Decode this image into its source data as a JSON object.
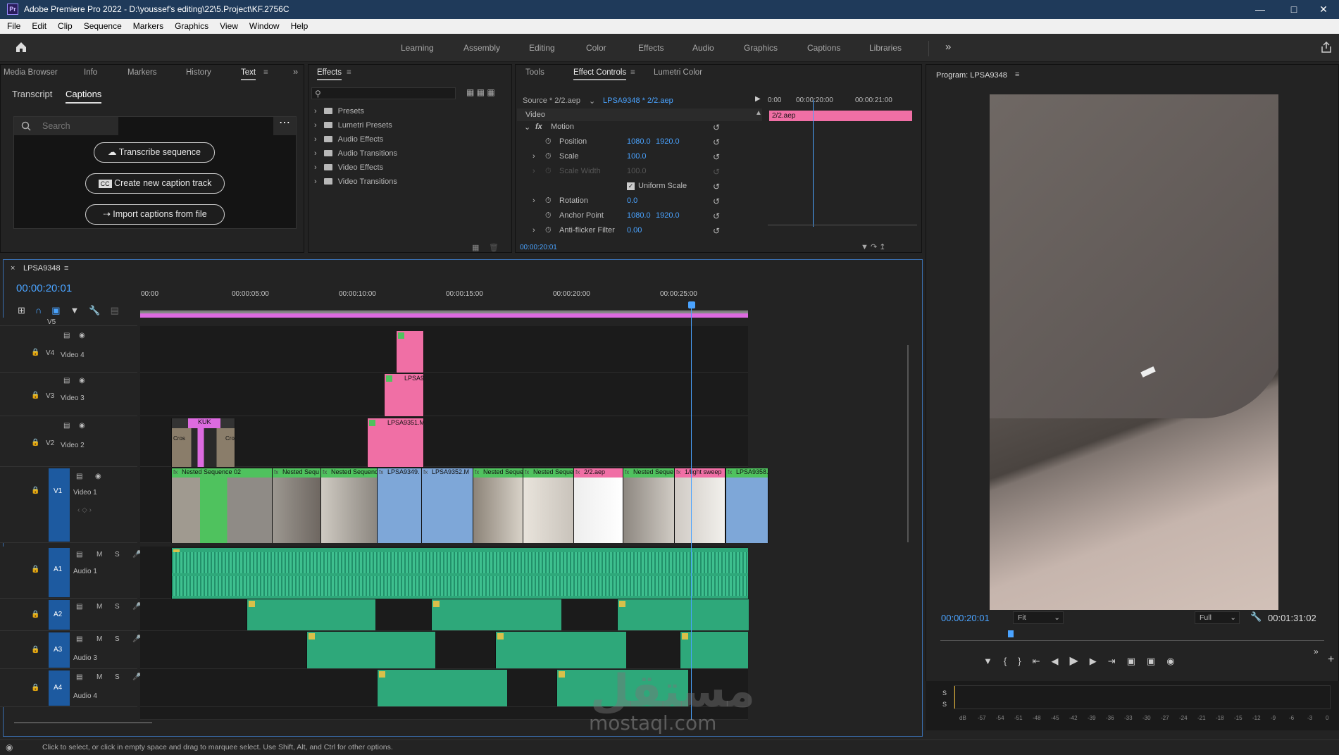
{
  "title": "Adobe Premiere Pro 2022 - D:\\youssef's editing\\22\\5.Project\\KF.2756C",
  "app_icon": "Pr",
  "menu": [
    "File",
    "Edit",
    "Clip",
    "Sequence",
    "Markers",
    "Graphics",
    "View",
    "Window",
    "Help"
  ],
  "workspaces": [
    "Learning",
    "Assembly",
    "Editing",
    "Color",
    "Effects",
    "Audio",
    "Graphics",
    "Captions",
    "Libraries"
  ],
  "left_panel": {
    "tabs": [
      "Media Browser",
      "Info",
      "Markers",
      "History",
      "Text"
    ],
    "subtabs": [
      "Transcript",
      "Captions"
    ],
    "search_placeholder": "Search",
    "buttons": [
      "Transcribe sequence",
      "Create new caption track",
      "Import captions from file"
    ]
  },
  "effects_panel": {
    "tab": "Effects",
    "items": [
      "Presets",
      "Lumetri Presets",
      "Audio Effects",
      "Audio Transitions",
      "Video Effects",
      "Video Transitions"
    ]
  },
  "effect_controls": {
    "tabs": [
      "Tools",
      "Effect Controls",
      "Lumetri Color"
    ],
    "source": "Source * 2/2.aep",
    "sequence": "LPSA9348 * 2/2.aep",
    "ruler": [
      "0:00",
      "00:00:20:00",
      "00:00:21:00"
    ],
    "clip_label": "2/2.aep",
    "section": "Video",
    "motion": "Motion",
    "rows": [
      {
        "name": "Position",
        "v1": "1080.0",
        "v2": "1920.0"
      },
      {
        "name": "Scale",
        "v1": "100.0",
        "v2": ""
      },
      {
        "name": "Scale Width",
        "v1": "100.0",
        "v2": ""
      },
      {
        "name": "Uniform Scale",
        "v1": "",
        "v2": ""
      },
      {
        "name": "Rotation",
        "v1": "0.0",
        "v2": ""
      },
      {
        "name": "Anchor Point",
        "v1": "1080.0",
        "v2": "1920.0"
      },
      {
        "name": "Anti-flicker Filter",
        "v1": "0.00",
        "v2": ""
      }
    ],
    "timecode": "00:00:20:01"
  },
  "program": {
    "title": "Program: LPSA9348",
    "timecode": "00:00:20:01",
    "fit": "Fit",
    "quality": "Full",
    "duration": "00:01:31:02"
  },
  "timeline": {
    "sequence": "LPSA9348",
    "timecode": "00:00:20:01",
    "ruler": [
      "00:00",
      "00:00:05:00",
      "00:00:10:00",
      "00:00:15:00",
      "00:00:20:00",
      "00:00:25:00"
    ],
    "tracks_video": [
      {
        "id": "V5",
        "name": ""
      },
      {
        "id": "V4",
        "name": "Video 4"
      },
      {
        "id": "V3",
        "name": "Video 3"
      },
      {
        "id": "V2",
        "name": "Video 2"
      },
      {
        "id": "V1",
        "name": "Video 1"
      }
    ],
    "tracks_audio": [
      {
        "id": "A1",
        "name": "Audio 1"
      },
      {
        "id": "A2",
        "name": ""
      },
      {
        "id": "A3",
        "name": "Audio 3"
      },
      {
        "id": "A4",
        "name": "Audio 4"
      }
    ],
    "v1_clips": [
      "Nested Sequence 02",
      "Nested Sequ",
      "Nested Sequenc",
      "LPSA9349.",
      "LPSA9352.M",
      "Nested Seque",
      "Nested Seque",
      "2/2.aep",
      "Nested Seque",
      "1/light sweep",
      "LPSA9358."
    ],
    "v2_clips": [
      "KUK",
      "Cros",
      "Cro",
      "LPSA9351.M"
    ],
    "v3_clips": [
      "LPSA9"
    ]
  },
  "meter_labels": [
    "dB",
    "-57",
    "-54",
    "-51",
    "-48",
    "-45",
    "-42",
    "-39",
    "-36",
    "-33",
    "-30",
    "-27",
    "-24",
    "-21",
    "-18",
    "-15",
    "-12",
    "-9",
    "-6",
    "-3",
    "0"
  ],
  "watermark": {
    "arabic": "مستقل",
    "latin": "mostaql.com"
  },
  "status": "Click to select, or click in empty space and drag to marquee select. Use Shift, Alt, and Ctrl for other options.",
  "colors": {
    "accent": "#4aa3ff",
    "clip_green": "#4fc25e",
    "clip_pink": "#f06fa5",
    "clip_purple": "#d87de0",
    "clip_blue": "#7ea7d8",
    "audio": "#2ea87a"
  }
}
